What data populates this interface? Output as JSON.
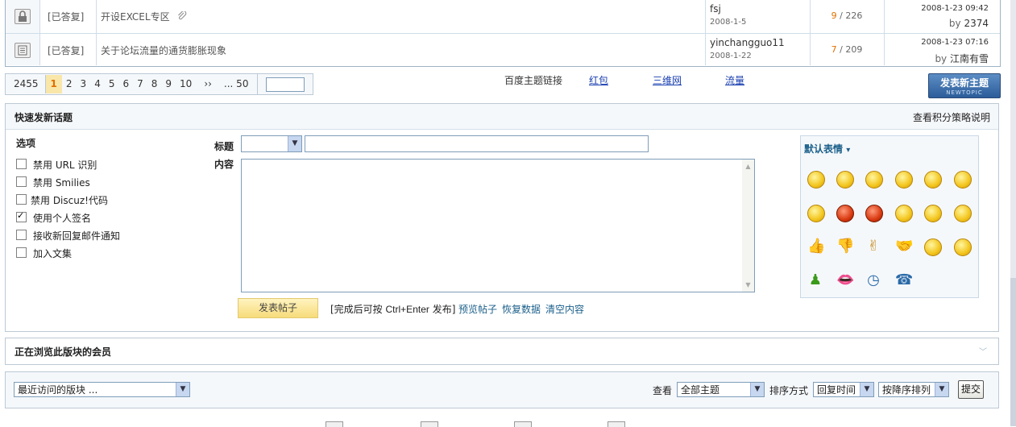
{
  "threads": [
    {
      "status": "[已答复]",
      "title": "开设EXCEL专区",
      "author": "fsj",
      "author_date": "2008-1-5",
      "replies": "9",
      "views": "226",
      "last_date": "2008-1-23 09:42",
      "last_by": "2374",
      "icon": "lock-icon",
      "has_attachment": true
    },
    {
      "status": "[已答复]",
      "title": "关于论坛流量的通货膨胀现象",
      "author": "yinchangguo11",
      "author_date": "2008-1-22",
      "replies": "7",
      "views": "209",
      "last_date": "2008-1-23 07:16",
      "last_by": "江南有雪",
      "icon": "document-icon",
      "has_attachment": false
    }
  ],
  "count_sep": " / ",
  "by_label": "by ",
  "pager": {
    "total": "2455",
    "pages": [
      "1",
      "2",
      "3",
      "4",
      "5",
      "6",
      "7",
      "8",
      "9",
      "10"
    ],
    "current": "1",
    "next": "››",
    "last": "... 50"
  },
  "baidu": {
    "label": "百度主题链接",
    "links": [
      "红包",
      "三维网",
      "流量"
    ]
  },
  "newtopic": {
    "label": "发表新主题",
    "sub": "NEWTOPIC"
  },
  "quickpost": {
    "title": "快速发新话题",
    "policy_link": "查看积分策略说明",
    "options_heading": "选项",
    "options": [
      {
        "label": "禁用 URL 识别",
        "checked": false
      },
      {
        "label": "禁用 Smilies",
        "checked": false
      },
      {
        "label": "禁用 Discuz!代码",
        "checked": false
      },
      {
        "label": "使用个人签名",
        "checked": true
      },
      {
        "label": "接收新回复邮件通知",
        "checked": false
      },
      {
        "label": "加入文集",
        "checked": false
      }
    ],
    "subject_label": "标题",
    "content_label": "内容",
    "submit_label": "发表帖子",
    "hint_pre": "[完成后可按",
    "hint_key": "Ctrl+Enter",
    "hint_post": "发布]",
    "actions": [
      "预览帖子",
      "恢复数据",
      "清空内容"
    ]
  },
  "smilies": {
    "title": "默认表情",
    "title_arrow": "▾"
  },
  "browsing": {
    "title": "正在浏览此版块的会员",
    "chevron": "﹀"
  },
  "bottom": {
    "forum_jump": "最近访问的版块 ...",
    "view_label": "查看",
    "view_value": "全部主题",
    "sort_label": "排序方式",
    "sort_by": "回复时间",
    "sort_order": "按降序排列",
    "submit": "提交"
  },
  "colors": {
    "accent": "#1a5f8a",
    "border": "#bcc9d4",
    "reply_count": "#e07000",
    "newtopic_bg": "#2c5d9a"
  }
}
